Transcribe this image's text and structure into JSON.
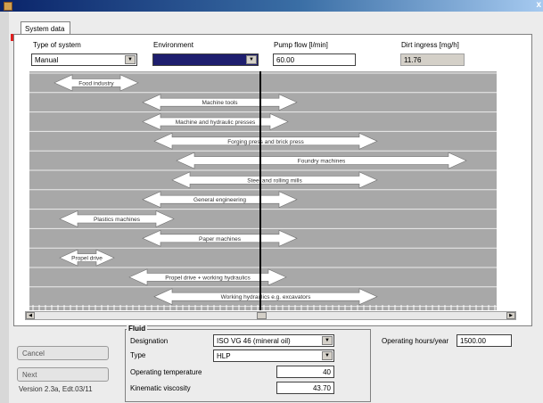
{
  "window": {
    "close_glyph": "x"
  },
  "tabs": [
    {
      "label": "System data"
    }
  ],
  "header": {
    "system_type": {
      "label": "Type of system",
      "value": "Manual"
    },
    "environment": {
      "label": "Environment",
      "value": ""
    },
    "pump_flow": {
      "label": "Pump flow [l/min]",
      "value": "60.00"
    },
    "dirt_ingress": {
      "label": "Dirt ingress [mg/h]",
      "value": "11.76"
    }
  },
  "chart": {
    "bands": [
      {
        "label": "Food industry"
      },
      {
        "label": "Machine tools"
      },
      {
        "label": "Machine and hydraulic presses"
      },
      {
        "label": "Forging press and brick press"
      },
      {
        "label": "Foundry machines"
      },
      {
        "label": "Steel and rolling mills"
      },
      {
        "label": "General engineering"
      },
      {
        "label": "Plastics machines"
      },
      {
        "label": "Paper machines"
      },
      {
        "label": "Propel drive"
      },
      {
        "label": "Propel drive + working hydraulics"
      },
      {
        "label": "Working hydraulics e.g. excavators"
      }
    ]
  },
  "buttons": {
    "cancel": "Cancel",
    "next": "Next"
  },
  "version": "Version 2.3a, Edt.03/11",
  "fluid": {
    "title": "Fluid",
    "designation": {
      "label": "Designation",
      "value": "ISO VG 46 (mineral oil)"
    },
    "type": {
      "label": "Type",
      "value": "HLP"
    },
    "operating_temperature": {
      "label": "Operating temperature",
      "value": "40"
    },
    "kinematic_viscosity": {
      "label": "Kinematic viscosity",
      "value": "43.70"
    }
  },
  "operating_hours": {
    "label": "Operating hours/year",
    "value": "1500.00"
  },
  "colors": {
    "band_bg": "#a8a8a8",
    "arrow_fill": "#ffffff",
    "titlebar": "#0a246a",
    "environment_fill": "#1e1e6e"
  },
  "icons": {
    "dropdown": "chevron-down-icon",
    "scroll_left": "triangle-left-icon",
    "scroll_right": "triangle-right-icon"
  }
}
